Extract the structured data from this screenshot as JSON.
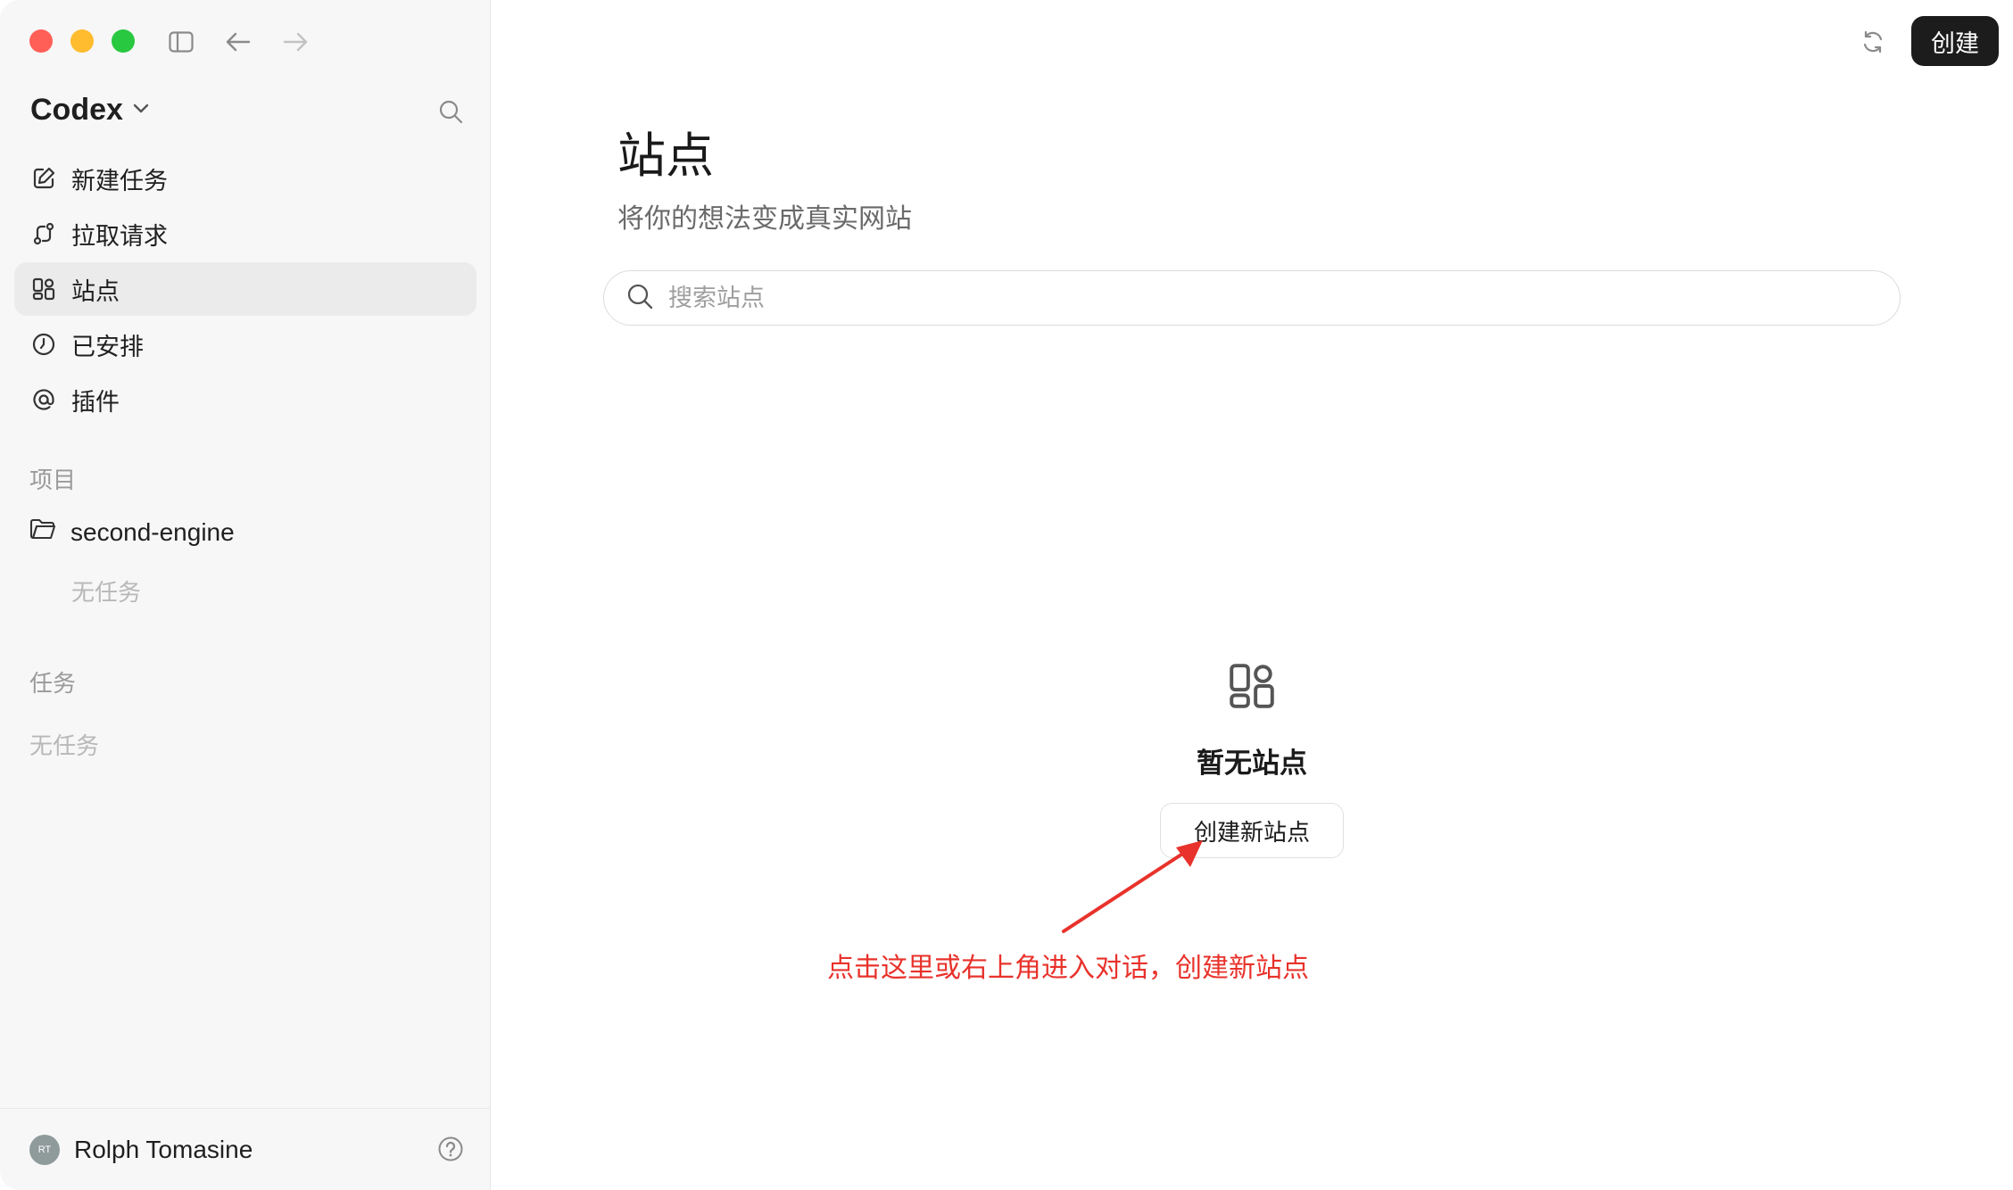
{
  "colors": {
    "accent_dark": "#1c1c1c",
    "annotation": "#e8322b",
    "sidebar_bg": "#f7f7f7",
    "active_item_bg": "#ebebeb"
  },
  "sidebar": {
    "brand": "Codex",
    "nav": [
      {
        "label": "新建任务",
        "icon": "edit-icon"
      },
      {
        "label": "拉取请求",
        "icon": "pull-request-icon"
      },
      {
        "label": "站点",
        "icon": "grid-icon",
        "active": true
      },
      {
        "label": "已安排",
        "icon": "clock-icon"
      },
      {
        "label": "插件",
        "icon": "at-icon"
      }
    ],
    "projects_label": "项目",
    "project_name": "second-engine",
    "project_empty": "无任务",
    "tasks_label": "任务",
    "tasks_empty": "无任务",
    "user": {
      "initials": "RT",
      "name": "Rolph Tomasine"
    }
  },
  "main": {
    "create_button": "创建",
    "title": "站点",
    "subtitle": "将你的想法变成真实网站",
    "search_placeholder": "搜索站点",
    "empty_title": "暂无站点",
    "create_new_button": "创建新站点",
    "annotation": "点击这里或右上角进入对话，创建新站点"
  }
}
